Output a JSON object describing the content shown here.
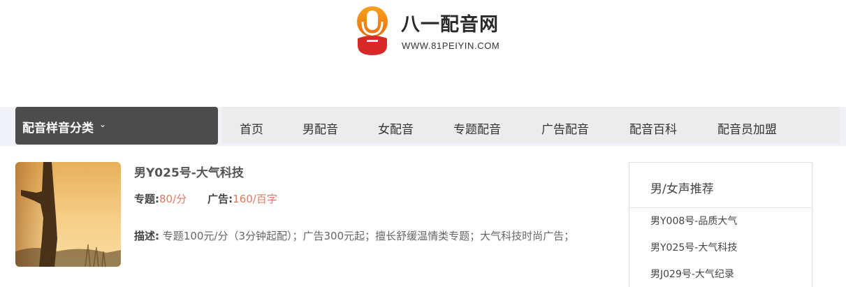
{
  "logo": {
    "title": "八一配音网",
    "url_text": "WWW.81PEIYIN.COM"
  },
  "nav": {
    "category_label": "配音样音分类",
    "category_chevron": "⌄",
    "items": [
      "首页",
      "男配音",
      "女配音",
      "专题配音",
      "广告配音",
      "配音百科",
      "配音员加盟"
    ]
  },
  "item": {
    "title": "男Y025号-大气科技",
    "special_label": "专题:",
    "special_price": "80/分",
    "ad_label": "广告:",
    "ad_price": "160/百字",
    "desc_label": "描述:",
    "desc_text": "专题100元/分（3分钟起配）；广告300元起；擅长舒缓温情类专题；大气科技时尚广告；"
  },
  "sidebar": {
    "title": "男/女声推荐",
    "links": [
      "男Y008号-品质大气",
      "男Y025号-大气科技",
      "男J029号-大气纪录"
    ]
  },
  "colors": {
    "accent": "#e2765f",
    "category_bg": "#4c4c4c",
    "menu_bg": "#ececec",
    "nav_band_bg": "#f0f2f7",
    "logo_orange": "#f07d1a",
    "logo_red": "#d8282a"
  },
  "icons": {
    "logo": "microphone-logo-icon",
    "category": "chevron-down-icon"
  }
}
